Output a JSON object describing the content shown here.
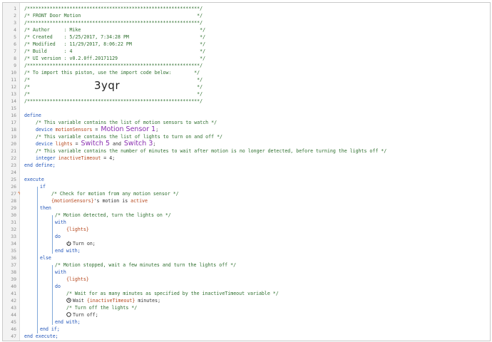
{
  "lines": [
    {
      "n": "1",
      "x": 30,
      "parts": [
        {
          "t": "/*************************************************************/",
          "c": "cm"
        }
      ]
    },
    {
      "n": "2",
      "x": 30,
      "parts": [
        {
          "t": "/* FRONT Door Motion                                         */",
          "c": "cm"
        }
      ]
    },
    {
      "n": "3",
      "x": 30,
      "parts": [
        {
          "t": "/*************************************************************/",
          "c": "cm"
        }
      ]
    },
    {
      "n": "4",
      "x": 30,
      "parts": [
        {
          "t": "/* Author     : Mike                                          */",
          "c": "cm"
        }
      ]
    },
    {
      "n": "5",
      "x": 30,
      "parts": [
        {
          "t": "/* Created    : 5/25/2017, 7:34:28 PM                         */",
          "c": "cm"
        }
      ]
    },
    {
      "n": "6",
      "x": 30,
      "parts": [
        {
          "t": "/* Modified   : 11/29/2017, 8:06:22 PM                        */",
          "c": "cm"
        }
      ]
    },
    {
      "n": "7",
      "x": 30,
      "parts": [
        {
          "t": "/* Build      : 4                                             */",
          "c": "cm"
        }
      ]
    },
    {
      "n": "8",
      "x": 30,
      "parts": [
        {
          "t": "/* UI version : v0.2.0ff.20171129                             */",
          "c": "cm"
        }
      ]
    },
    {
      "n": "9",
      "x": 30,
      "parts": [
        {
          "t": "/*************************************************************/",
          "c": "cm"
        }
      ]
    },
    {
      "n": "10",
      "x": 30,
      "parts": [
        {
          "t": "/* To import this piston, use the import code below:        */",
          "c": "cm"
        }
      ]
    },
    {
      "n": "11",
      "x": 30,
      "parts": [
        {
          "t": "/*                                                           */",
          "c": "cm"
        }
      ]
    },
    {
      "n": "12",
      "x": 30,
      "parts": [
        {
          "t": "/*                                                           */",
          "c": "cm"
        }
      ]
    },
    {
      "n": "13",
      "x": 30,
      "parts": [
        {
          "t": "/*                                                           */",
          "c": "cm"
        }
      ]
    },
    {
      "n": "14",
      "x": 30,
      "parts": [
        {
          "t": "/*************************************************************/",
          "c": "cm"
        }
      ]
    },
    {
      "n": "15",
      "x": 30,
      "parts": []
    },
    {
      "n": "16",
      "x": 30,
      "parts": [
        {
          "t": "define",
          "c": "kw"
        }
      ]
    },
    {
      "n": "17",
      "x": 46,
      "parts": [
        {
          "t": "/* This variable contains the list of motion sensors to watch */",
          "c": "cm"
        }
      ]
    },
    {
      "n": "18",
      "x": 46,
      "parts": [
        {
          "t": "device ",
          "c": "kw"
        },
        {
          "t": "motionSensors",
          "c": "va"
        },
        {
          "t": " = ",
          "c": ""
        },
        {
          "t": "Motion Sensor 1",
          "c": "big"
        },
        {
          "t": ";",
          "c": ""
        }
      ]
    },
    {
      "n": "19",
      "x": 46,
      "parts": [
        {
          "t": "/* This variable contains the list of lights to turn on and off */",
          "c": "cm"
        }
      ]
    },
    {
      "n": "20",
      "x": 46,
      "parts": [
        {
          "t": "device ",
          "c": "kw"
        },
        {
          "t": "lights",
          "c": "va"
        },
        {
          "t": " = ",
          "c": ""
        },
        {
          "t": "Switch 5",
          "c": "big"
        },
        {
          "t": " and ",
          "c": ""
        },
        {
          "t": "Switch 3",
          "c": "big"
        },
        {
          "t": ";",
          "c": ""
        }
      ]
    },
    {
      "n": "21",
      "x": 46,
      "parts": [
        {
          "t": "/* This variable contains the number of minutes to wait after motion is no longer detected, before turning the lights off */",
          "c": "cm"
        }
      ]
    },
    {
      "n": "22",
      "x": 46,
      "parts": [
        {
          "t": "integer ",
          "c": "kw"
        },
        {
          "t": "inactiveTimeout",
          "c": "va"
        },
        {
          "t": " = 4;",
          "c": ""
        }
      ]
    },
    {
      "n": "23",
      "x": 30,
      "parts": [
        {
          "t": "end define;",
          "c": "kw"
        }
      ]
    },
    {
      "n": "24",
      "x": 30,
      "parts": []
    },
    {
      "n": "25",
      "x": 30,
      "parts": [
        {
          "t": "execute",
          "c": "kw"
        }
      ]
    },
    {
      "n": "26",
      "x": 52,
      "parts": [
        {
          "t": "if",
          "c": "kw"
        }
      ]
    },
    {
      "n": "27",
      "x": 68,
      "mark": "ϟ",
      "parts": [
        {
          "t": "/* Check for motion from any motion sensor */",
          "c": "cm"
        }
      ]
    },
    {
      "n": "28",
      "x": 68,
      "parts": [
        {
          "t": "{motionSensors}",
          "c": "va"
        },
        {
          "t": "'s motion is ",
          "c": ""
        },
        {
          "t": "active",
          "c": "va"
        }
      ]
    },
    {
      "n": "29",
      "x": 52,
      "parts": [
        {
          "t": "then",
          "c": "kw"
        }
      ]
    },
    {
      "n": "30",
      "x": 73,
      "parts": [
        {
          "t": "/* Motion detected, turn the lights on */",
          "c": "cm"
        }
      ]
    },
    {
      "n": "31",
      "x": 73,
      "parts": [
        {
          "t": "with",
          "c": "kw"
        }
      ]
    },
    {
      "n": "32",
      "x": 89,
      "parts": [
        {
          "t": "{lights}",
          "c": "va"
        }
      ]
    },
    {
      "n": "33",
      "x": 73,
      "parts": [
        {
          "t": "do",
          "c": "kw"
        }
      ]
    },
    {
      "n": "34",
      "x": 89,
      "icon": "power-icon",
      "parts": [
        {
          "t": "Turn on;",
          "c": ""
        }
      ]
    },
    {
      "n": "35",
      "x": 73,
      "parts": [
        {
          "t": "end with;",
          "c": "kw"
        }
      ]
    },
    {
      "n": "36",
      "x": 52,
      "parts": [
        {
          "t": "else",
          "c": "kw"
        }
      ]
    },
    {
      "n": "37",
      "x": 73,
      "parts": [
        {
          "t": "/* Motion stopped, wait a few minutes and turn the lights off */",
          "c": "cm"
        }
      ]
    },
    {
      "n": "38",
      "x": 73,
      "parts": [
        {
          "t": "with",
          "c": "kw"
        }
      ]
    },
    {
      "n": "39",
      "x": 89,
      "parts": [
        {
          "t": "{lights}",
          "c": "va"
        }
      ]
    },
    {
      "n": "40",
      "x": 73,
      "parts": [
        {
          "t": "do",
          "c": "kw"
        }
      ]
    },
    {
      "n": "41",
      "x": 89,
      "parts": [
        {
          "t": "/* Wait for as many minutes as specified by the inactiveTimeout variable */",
          "c": "cm"
        }
      ]
    },
    {
      "n": "42",
      "x": 89,
      "icon": "clock-icon",
      "parts": [
        {
          "t": "Wait ",
          "c": ""
        },
        {
          "t": "{inactiveTimeout}",
          "c": "va"
        },
        {
          "t": " minutes;",
          "c": ""
        }
      ]
    },
    {
      "n": "43",
      "x": 89,
      "parts": [
        {
          "t": "/* Turn off the lights */",
          "c": "cm"
        }
      ]
    },
    {
      "n": "44",
      "x": 89,
      "icon": "circle-icon",
      "parts": [
        {
          "t": "Turn off;",
          "c": ""
        }
      ]
    },
    {
      "n": "45",
      "x": 73,
      "parts": [
        {
          "t": "end with;",
          "c": "kw"
        }
      ]
    },
    {
      "n": "46",
      "x": 52,
      "parts": [
        {
          "t": "end if;",
          "c": "kw"
        }
      ]
    },
    {
      "n": "47",
      "x": 30,
      "parts": [
        {
          "t": "end execute;",
          "c": "kw"
        }
      ]
    }
  ],
  "import_code": "3yqr",
  "colors": {
    "comment": "#2e6f2e",
    "keyword": "#1f53b8",
    "variable": "#b5461b",
    "device": "#8a2fb0",
    "guide": "#7fa7d8"
  }
}
